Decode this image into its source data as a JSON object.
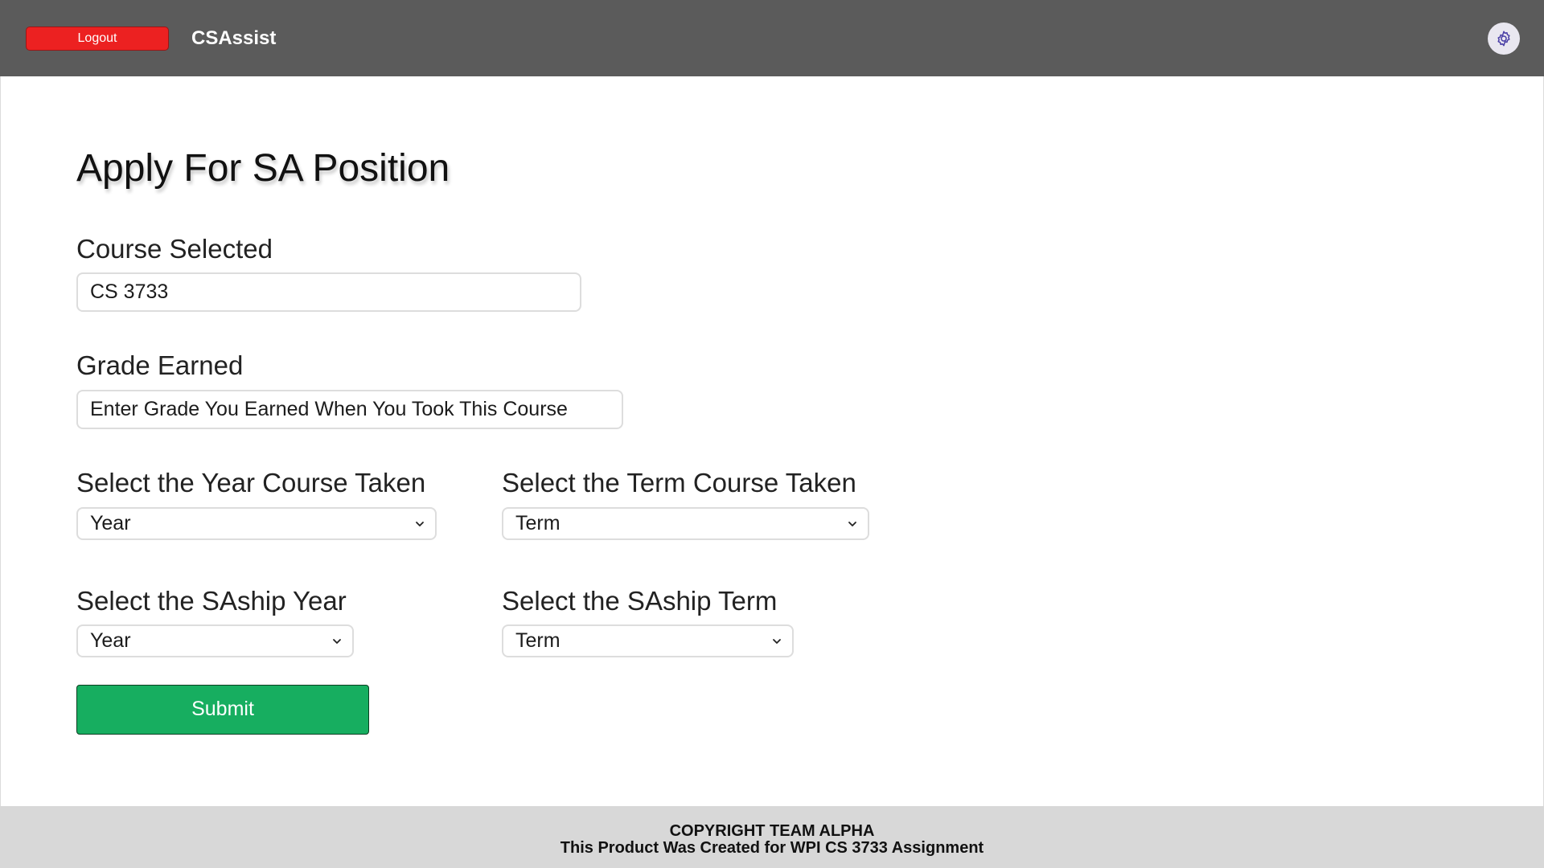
{
  "header": {
    "logout_label": "Logout",
    "brand": "CSAssist",
    "settings_icon": "gear-icon",
    "colors": {
      "bar": "#5b5b5b",
      "logout": "#ec2121"
    }
  },
  "main": {
    "title": "Apply For SA Position",
    "course": {
      "label": "Course Selected",
      "value": "CS 3733"
    },
    "grade": {
      "label": "Grade Earned",
      "placeholder": "Enter Grade You Earned When You Took This Course"
    },
    "course_year": {
      "label": "Select the Year Course Taken",
      "selected": "Year"
    },
    "course_term": {
      "label": "Select the Term Course Taken",
      "selected": "Term"
    },
    "saship_year": {
      "label": "Select the SAship Year",
      "selected": "Year"
    },
    "saship_term": {
      "label": "Select the SAship Term",
      "selected": "Term"
    },
    "submit_label": "Submit",
    "colors": {
      "submit": "#17ae60"
    }
  },
  "footer": {
    "line1": "COPYRIGHT TEAM ALPHA",
    "line2": "This Product Was Created for WPI CS 3733 Assignment"
  }
}
